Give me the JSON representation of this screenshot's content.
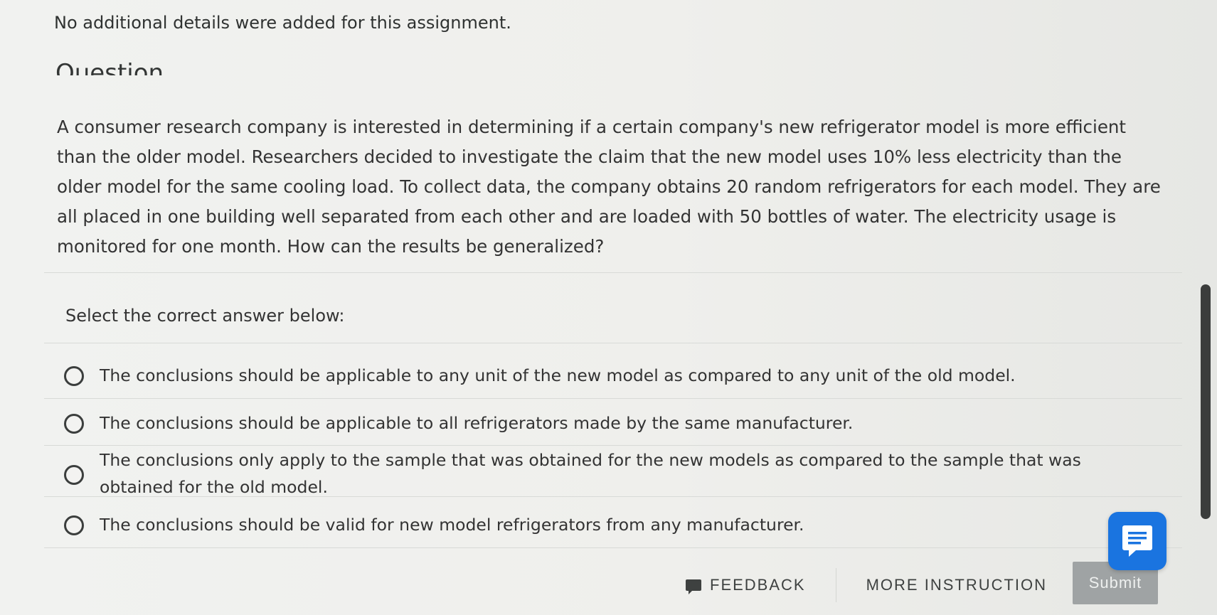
{
  "assignment": {
    "details": "No additional details were added for this assignment."
  },
  "question": {
    "heading": "Question",
    "text": "A consumer research company is interested in determining if a certain company's new refrigerator model is more efficient than the older model. Researchers decided to investigate the claim that the new model uses 10% less electricity than the older model for the same cooling load. To collect data, the company obtains 20 random refrigerators for each model. They are all placed in one building well separated from each other and are loaded with 50 bottles of water. The electricity usage is monitored for one month. How can the results be generalized?"
  },
  "answer": {
    "prompt": "Select the correct answer below:",
    "options": [
      {
        "label": "The conclusions should be applicable to any unit of the new model as compared to any unit of the old model."
      },
      {
        "label": "The conclusions should be applicable to all refrigerators made by the same manufacturer."
      },
      {
        "label": "The conclusions only apply to the sample that was obtained for the new models as compared to the sample that was obtained for the old model."
      },
      {
        "label": "The conclusions should be valid for new model refrigerators from any manufacturer."
      }
    ]
  },
  "footer": {
    "feedback_label": "FEEDBACK",
    "more_instruction_label": "MORE INSTRUCTION",
    "submit_label": "Submit"
  },
  "icons": {
    "feedback": "feedback-icon",
    "chat": "chat-icon"
  },
  "colors": {
    "chat_button": "#1a74e0",
    "submit_button": "#9fa3a4"
  }
}
